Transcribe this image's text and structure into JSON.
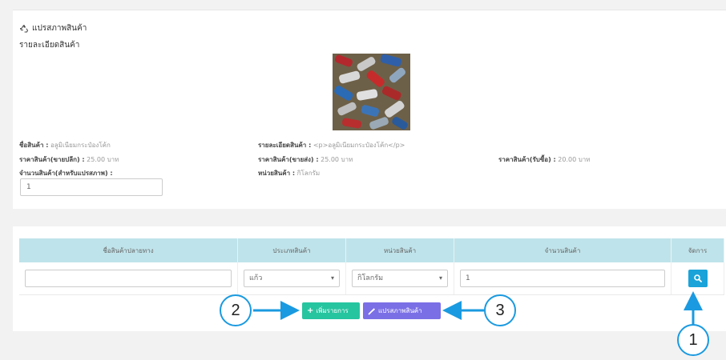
{
  "page": {
    "title": "แปรสภาพสินค้า",
    "subtitle": "รายละเอียดสินค้า"
  },
  "product": {
    "name_label": "ชื่อสินค้า :",
    "name_value": "อลูมิเนียมกระป๋องโค้ก",
    "detail_label": "รายละเอียดสินค้า :",
    "detail_value": "<p>อลูมิเนียมกระป๋องโค้ก</p>",
    "retail_label": "ราคาสินค้า(ขายปลีก) :",
    "retail_value": "25.00 บาท",
    "wholesale_label": "ราคาสินค้า(ขายส่ง) :",
    "wholesale_value": "25.00 บาท",
    "buy_label": "ราคาสินค้า(รับซื้อ) :",
    "buy_value": "20.00 บาท",
    "qty_label": "จำนวนสินค้า(สำหรับแปรสภาพ) :",
    "qty_value": "1",
    "unit_label": "หน่วยสินค้า :",
    "unit_value": "กิโลกรัม"
  },
  "table": {
    "headers": [
      "ชื่อสินค้าปลายทาง",
      "ประเภทสินค้า",
      "หน่วยสินค้า",
      "จำนวนสินค้า",
      "จัดการ"
    ],
    "row": {
      "dest_name": "",
      "type": "แก้ว",
      "unit": "กิโลกรัม",
      "qty": "1"
    }
  },
  "buttons": {
    "add": "เพิ่มรายการ",
    "convert": "แปรสภาพสินค้า"
  },
  "callouts": [
    "1",
    "2",
    "3"
  ],
  "colors": {
    "header_bg": "#bfe3ea",
    "add_btn": "#26c5a0",
    "convert_btn": "#7b6fe6",
    "search_btn": "#1aa3d9",
    "callout": "#1a9ae0"
  },
  "icons": {
    "title": "recycle-icon",
    "add": "plus-icon",
    "convert": "wrench-icon",
    "action": "search-icon"
  }
}
